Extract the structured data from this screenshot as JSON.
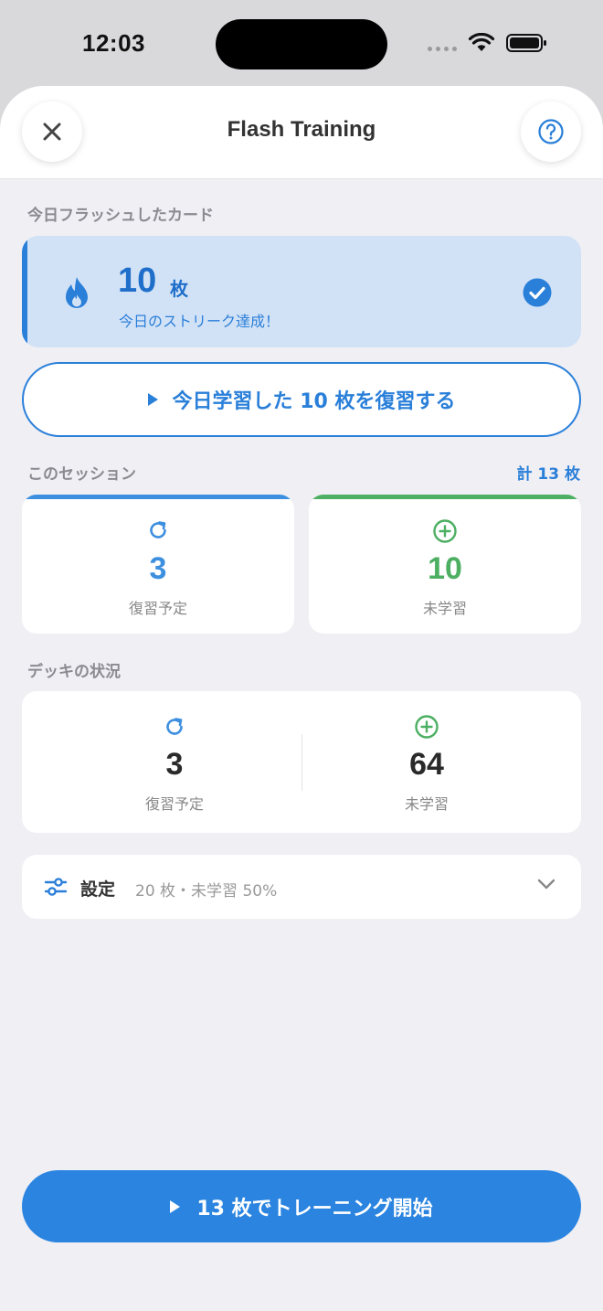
{
  "status_bar": {
    "time": "12:03"
  },
  "header": {
    "title": "Flash Training"
  },
  "today": {
    "section_label": "今日フラッシュしたカード",
    "count": "10",
    "unit": "枚",
    "streak_text": "今日のストリーク達成！",
    "review_button_label": "今日学習した 10 枚を復習する"
  },
  "session": {
    "section_label": "このセッション",
    "total_label": "計 13 枚",
    "review": {
      "value": "3",
      "label": "復習予定",
      "color": "#3d8fe0"
    },
    "new": {
      "value": "10",
      "label": "未学習",
      "color": "#4caf62"
    }
  },
  "deck": {
    "section_label": "デッキの状況",
    "review": {
      "value": "3",
      "label": "復習予定"
    },
    "new": {
      "value": "64",
      "label": "未学習"
    }
  },
  "settings": {
    "title": "設定",
    "summary": "20 枚・未学習 50%"
  },
  "start_button_label": "13 枚でトレーニング開始",
  "colors": {
    "accent": "#2a7fd9",
    "green": "#4caf62",
    "background": "#efeff4"
  },
  "icons": [
    "close-icon",
    "help-icon",
    "flame-icon",
    "check-circle-icon",
    "play-icon",
    "refresh-icon",
    "plus-circle-icon",
    "sliders-icon",
    "chevron-down-icon"
  ]
}
